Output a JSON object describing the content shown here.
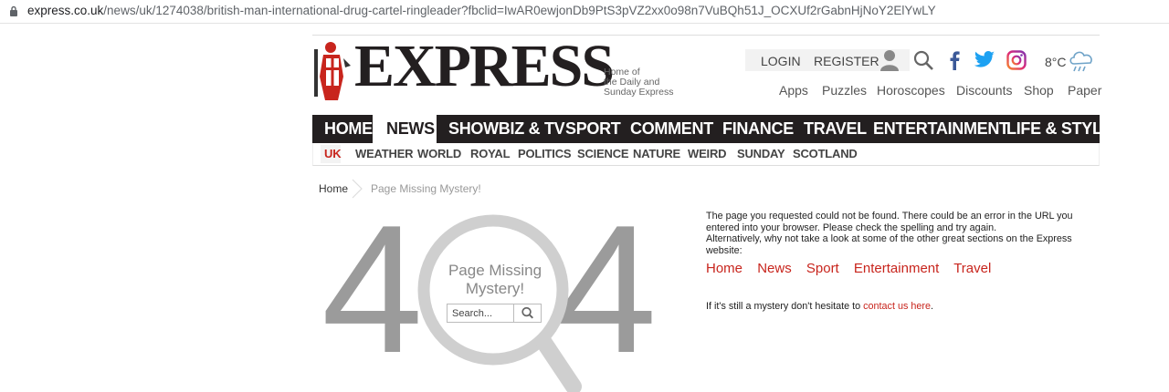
{
  "browser": {
    "url_host": "express.co.uk",
    "url_path": "/news/uk/1274038/british-man-international-drug-cartel-ringleader?fbclid=IwAR0ewjonDb9PtS3pVZ2xx0o98n7VuBQh51J_OCXUf2rGabnHjNoY2ElYwLY"
  },
  "header": {
    "logo": "EXPRESS",
    "tagline": [
      "Home of",
      "the Daily and",
      "Sunday Express"
    ],
    "login": "LOGIN",
    "register": "REGISTER",
    "temperature": "8°C",
    "utility_links": [
      "Apps",
      "Puzzles",
      "Horoscopes",
      "Discounts",
      "Shop",
      "Paper"
    ]
  },
  "main_nav": {
    "items": [
      "HOME",
      "NEWS",
      "SHOWBIZ & TV",
      "SPORT",
      "COMMENT",
      "FINANCE",
      "TRAVEL",
      "ENTERTAINMENT",
      "LIFE & STYLE"
    ],
    "active": "NEWS"
  },
  "sub_nav": {
    "items": [
      "UK",
      "WEATHER",
      "WORLD",
      "ROYAL",
      "POLITICS",
      "SCIENCE",
      "NATURE",
      "WEIRD",
      "SUNDAY",
      "SCOTLAND"
    ],
    "active": "UK"
  },
  "breadcrumb": {
    "home": "Home",
    "current": "Page Missing Mystery!"
  },
  "error": {
    "digit_left": "4",
    "digit_right": "4",
    "glass_title": "Page Missing Mystery!",
    "search_placeholder": "Search...",
    "message_lines": [
      "The page you requested could not be found. There could be an error in the URL you",
      "entered into your browser. Please check the spelling and try again.",
      "Alternatively, why not take a look at some of the other great sections on the Express",
      "website:"
    ],
    "section_links": [
      "Home",
      "News",
      "Sport",
      "Entertainment",
      "Travel"
    ],
    "mystery_prefix": "If it's still a mystery don't hesitate to ",
    "mystery_link": "contact us here",
    "mystery_suffix": "."
  },
  "colors": {
    "brand_red": "#c8251d",
    "nav_dark": "#231f20",
    "digit_gray": "#9b9b9b"
  },
  "icons": [
    "lock-icon",
    "crusader-crest-icon",
    "user-icon",
    "search-icon",
    "facebook-icon",
    "twitter-icon",
    "instagram-icon",
    "weather-rain-icon",
    "chevron-right-icon",
    "magnifier-icon"
  ]
}
